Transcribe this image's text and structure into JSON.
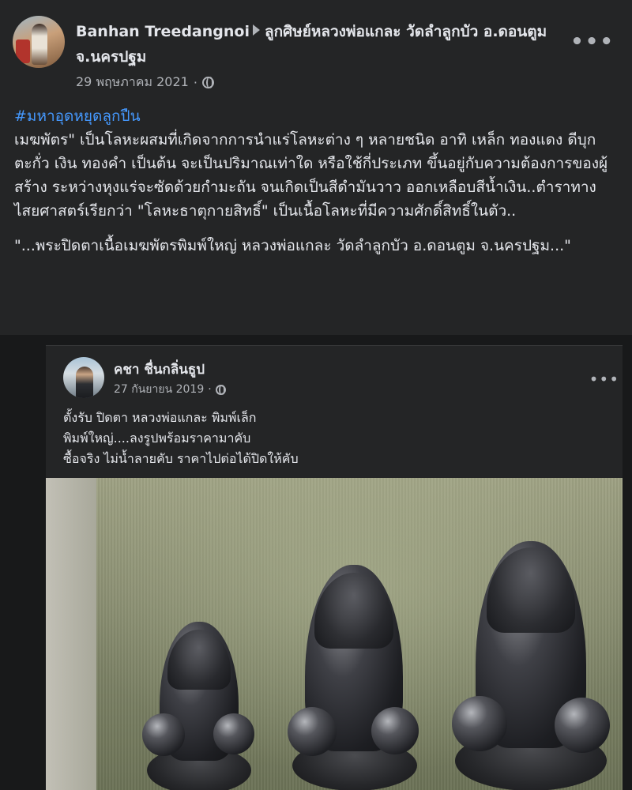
{
  "top_post": {
    "author": "Banhan Treedangnoi",
    "group": "ลูกศิษย์หลวงพ่อแกละ วัดลำลูกบัว อ.ดอนตูม จ.นครปฐม",
    "date": "29 พฤษภาคม 2021",
    "more_label": "•••",
    "hashtag": "#มหาอุดหยุดลูกปืน",
    "paragraph1": "เมฆพัตร\" เป็นโลหะผสมที่เกิดจากการนำแร่โลหะต่าง ๆ หลายชนิด อาทิ เหล็ก ทองแดง ดีบุก ตะกั่ว เงิน ทองคำ เป็นต้น จะเป็นปริมาณเท่าใด หรือใช้กี่ประเภท ขึ้นอยู่กับความต้องการของผู้สร้าง ระหว่างหุงแร่จะซัดด้วยกำมะถัน จนเกิดเป็นสีดำมันวาว ออกเหลือบสีน้ำเงิน..ตำราทางไสยศาสตร์เรียกว่า \"โลหะธาตุกายสิทธิ์\" เป็นเนื้อโลหะที่มีความศักดิ์สิทธิ์ในตัว..",
    "paragraph2": "\"...พระปิดตาเนื้อเมฆพัตรพิมพ์ใหญ่ หลวงพ่อแกละ วัดลำลูกบัว อ.ดอนตูม จ.นครปฐม...\""
  },
  "shared_post": {
    "author": "คชา ชื่นกลิ่นธูป",
    "date": "27 กันยายน 2019",
    "more_label": "•••",
    "lines": [
      "ตั้งรับ ปิดตา หลวงพ่อแกละ พิมพ์เล็ก",
      "พิมพ์ใหญ่....ลงรูปพร้อมราคามาคับ",
      "ซื้อจริง ไม่น้ำลายคับ ราคาไปต่อได้ปิดให้คับ"
    ]
  }
}
